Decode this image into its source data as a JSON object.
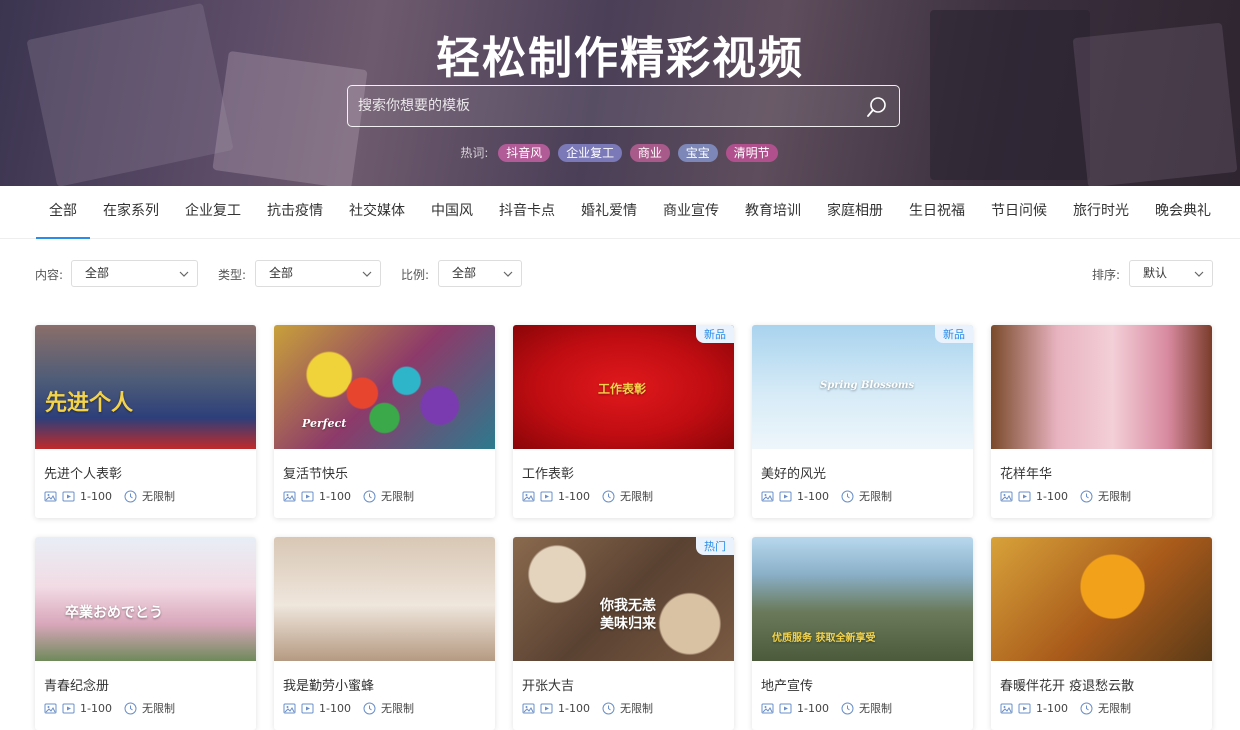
{
  "hero": {
    "title": "轻松制作精彩视频",
    "search_placeholder": "搜索你想要的模板",
    "hot_label": "热词:",
    "hot_tags": [
      {
        "label": "抖音风",
        "color": "#b25c97"
      },
      {
        "label": "企业复工",
        "color": "#7b79b8"
      },
      {
        "label": "商业",
        "color": "#a85a8a"
      },
      {
        "label": "宝宝",
        "color": "#7d87b8"
      },
      {
        "label": "清明节",
        "color": "#b0518e"
      }
    ]
  },
  "categories": [
    "全部",
    "在家系列",
    "企业复工",
    "抗击疫情",
    "社交媒体",
    "中国风",
    "抖音卡点",
    "婚礼爱情",
    "商业宣传",
    "教育培训",
    "家庭相册",
    "生日祝福",
    "节日问候",
    "旅行时光",
    "晚会典礼"
  ],
  "active_category": "全部",
  "filters": {
    "content_label": "内容:",
    "content_value": "全部",
    "type_label": "类型:",
    "type_value": "全部",
    "ratio_label": "比例:",
    "ratio_value": "全部",
    "sort_label": "排序:",
    "sort_value": "默认"
  },
  "meta": {
    "range": "1-100",
    "duration": "无限制"
  },
  "cards": [
    {
      "title": "先进个人表彰",
      "badge": "",
      "thumb_text": "先进个人"
    },
    {
      "title": "复活节快乐",
      "badge": "",
      "thumb_text": "Perfect"
    },
    {
      "title": "工作表彰",
      "badge": "新品",
      "thumb_text": "工作表彰"
    },
    {
      "title": "美好的风光",
      "badge": "新品",
      "thumb_text": "Spring Blossoms"
    },
    {
      "title": "花样年华",
      "badge": "",
      "thumb_text": ""
    },
    {
      "title": "青春纪念册",
      "badge": "",
      "thumb_text": "卒業おめでとう"
    },
    {
      "title": "我是勤劳小蜜蜂",
      "badge": "",
      "thumb_text": ""
    },
    {
      "title": "开张大吉",
      "badge": "热门",
      "thumb_text": "你我无恙 美味归来"
    },
    {
      "title": "地产宣传",
      "badge": "",
      "thumb_text": "优质服务 获取全新享受"
    },
    {
      "title": "春暖伴花开 疫退愁云散",
      "badge": "",
      "thumb_text": ""
    }
  ]
}
